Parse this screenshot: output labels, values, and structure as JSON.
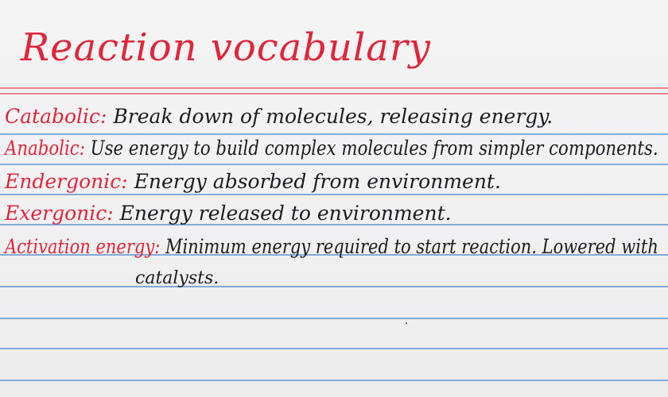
{
  "card": {
    "title": "Reaction vocabulary",
    "entries": [
      {
        "term": "Catabolic:",
        "definition": "Break down of molecules,  releasing energy."
      },
      {
        "term": "Anabolic:",
        "definition": "Use energy  to build complex molecules from simpler components."
      },
      {
        "term": "Endergonic:",
        "definition": "Energy  absorbed from environment."
      },
      {
        "term": "Exergonic:",
        "definition": "Energy released to environment."
      },
      {
        "term": "Activation energy:",
        "definition": "Minimum energy required to start reaction. Lowered with",
        "continuation": "catalysts."
      }
    ]
  },
  "colors": {
    "card": "#f3f3f4",
    "ink_red": "#e0263a",
    "ink_black": "#1b1b22",
    "rule_red": "#e9868a",
    "rule_blue": "#6f9fd2"
  }
}
